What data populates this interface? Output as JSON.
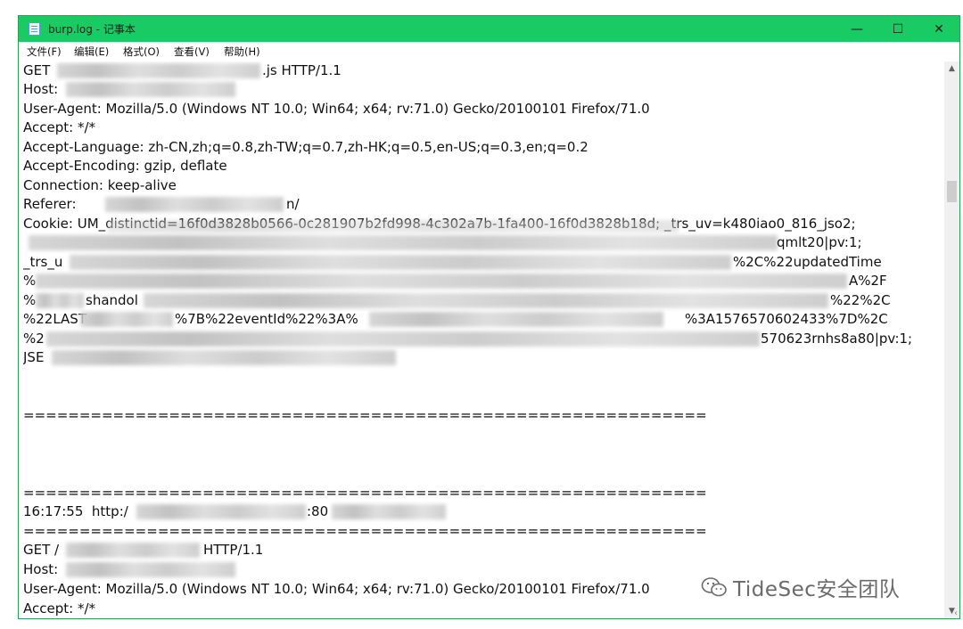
{
  "window": {
    "title": "burp.log - 记事本",
    "minimize_glyph": "—",
    "maximize_glyph": "☐",
    "close_glyph": "✕"
  },
  "menu": [
    "文件(F)",
    "编辑(E)",
    "格式(O)",
    "查看(V)",
    "帮助(H)"
  ],
  "lines": {
    "l0_get": "GET",
    "l0_tail": ".js HTTP/1.1",
    "l1": "Host:",
    "l2": "User-Agent: Mozilla/5.0 (Windows NT 10.0; Win64; x64; rv:71.0) Gecko/20100101 Firefox/71.0",
    "l3": "Accept: */*",
    "l4": "Accept-Language: zh-CN,zh;q=0.8,zh-TW;q=0.7,zh-HK;q=0.5,en-US;q=0.3,en;q=0.2",
    "l5": "Accept-Encoding: gzip, deflate",
    "l6": "Connection: keep-alive",
    "l7_head": "Referer:",
    "l7_tail": "n/",
    "l8": "Cookie: UM_distinctid=16f0d3828b0566-0c281907b2fd998-4c302a7b-1fa400-16f0d3828b18d; _trs_uv=k480iao0_816_jso2;",
    "l9_tail": "qmlt20|pv:1;",
    "l10_head": "_trs_u",
    "l10_tail": "%2C%22updatedTime",
    "l11_head": "%",
    "l11_tail": "A%2F",
    "l12_head": "%",
    "l12_mid": "shandol",
    "l12_tail": "%22%2C",
    "l13_head": "%22LAST",
    "l13_mid": "%7B%22eventId%22%3A%",
    "l13_tail": "%3A1576570602433%7D%2C",
    "l14_head": "%2",
    "l14_tail": "570623rnhs8a80|pv:1;",
    "l15_head": "JSE",
    "sep": "=============================================================",
    "ts_head": "16:17:55  http:/",
    "ts_tail": ":80",
    "g2_get": "GET /",
    "g2_tail": "HTTP/1.1",
    "h2": "Host:",
    "ua2": "User-Agent: Mozilla/5.0 (Windows NT 10.0; Win64; x64; rv:71.0) Gecko/20100101 Firefox/71.0",
    "acc2": "Accept: */*"
  },
  "watermark": "TideSec安全团队",
  "colors": {
    "titlebar": "#1aca63",
    "frame": "#2f9e57"
  }
}
